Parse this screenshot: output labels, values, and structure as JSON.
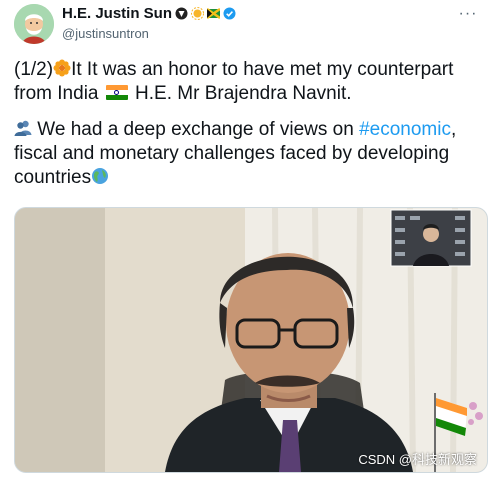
{
  "author": {
    "display_name": "H.E. Justin Sun",
    "handle": "@justinsuntron"
  },
  "tweet": {
    "prefix": "(1/2)",
    "line1_part1": "It It was an honor to have met my counterpart from India ",
    "line1_part2": " H.E. Mr Brajendra Navnit.",
    "line2_part1": " We had a deep exchange of views on ",
    "hashtag": "#economic",
    "line2_part2": ", fiscal and monetary challenges faced by developing countries"
  },
  "media": {
    "watermark": "CSDN @科技新观察"
  },
  "icons": {
    "avatar": "avatar-icon",
    "more": "more-icon",
    "verified": "verified-badge-icon",
    "flower": "flower-emoji-icon",
    "globe": "globe-emoji-icon",
    "people": "people-emoji-icon",
    "india_flag": "india-flag-icon"
  },
  "colors": {
    "link": "#1d9bf0",
    "text": "#0f1419",
    "secondary": "#536471"
  }
}
